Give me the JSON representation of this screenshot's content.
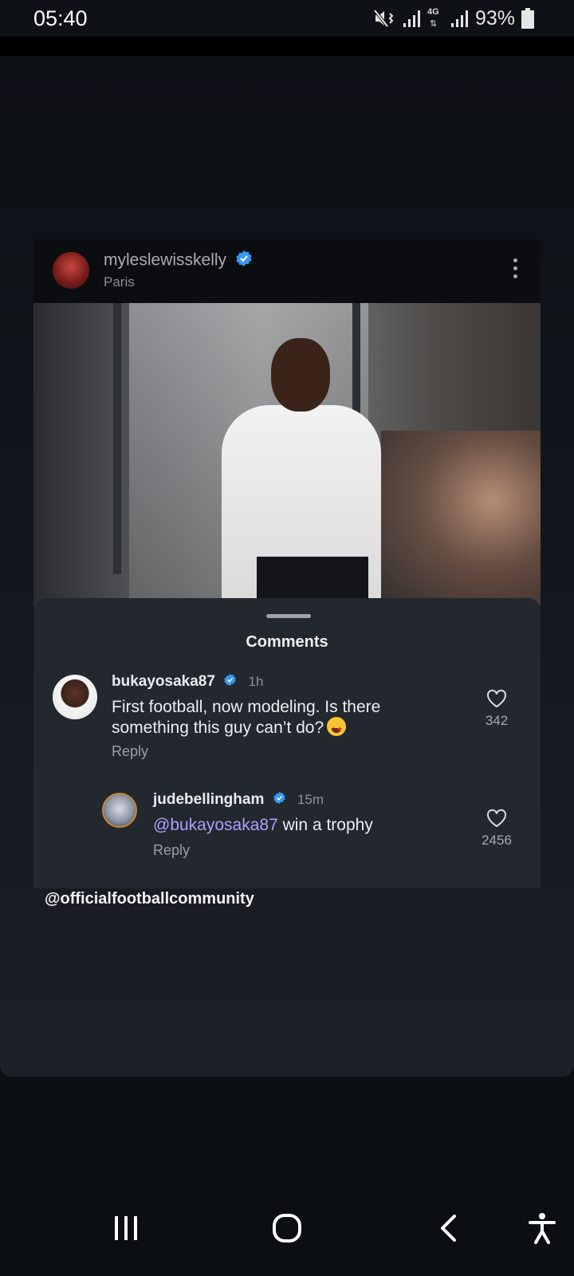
{
  "status_bar": {
    "time": "05:40",
    "battery": "93%",
    "network": "4G",
    "icons": [
      "mute-vibrate-icon",
      "signal-icon",
      "signal-icon",
      "battery-icon"
    ]
  },
  "post": {
    "username": "myleslewisskelly",
    "verified": true,
    "location": "Paris",
    "menu_icon": "more-vertical-icon"
  },
  "comments_sheet": {
    "title": "Comments",
    "comments": [
      {
        "username": "bukayosaka87",
        "verified": true,
        "time": "1h",
        "text": "First football, now modeling. Is there something this guy can’t do?",
        "emoji": "star-struck-emoji",
        "reply_label": "Reply",
        "likes": "342"
      },
      {
        "username": "judebellingham",
        "verified": true,
        "time": "15m",
        "mention": "@bukayosaka87",
        "text": " win a trophy",
        "reply_label": "Reply",
        "likes": "2456"
      }
    ]
  },
  "story_caption": "@officialfootballcommunity",
  "nav_bar": {
    "buttons": [
      "recent-apps-icon",
      "home-icon",
      "back-icon",
      "accessibility-icon"
    ]
  },
  "colors": {
    "background": "#0b0e13",
    "sheet": "#23272e",
    "verified_blue": "#3897f0",
    "mention": "#a8a2ff"
  }
}
